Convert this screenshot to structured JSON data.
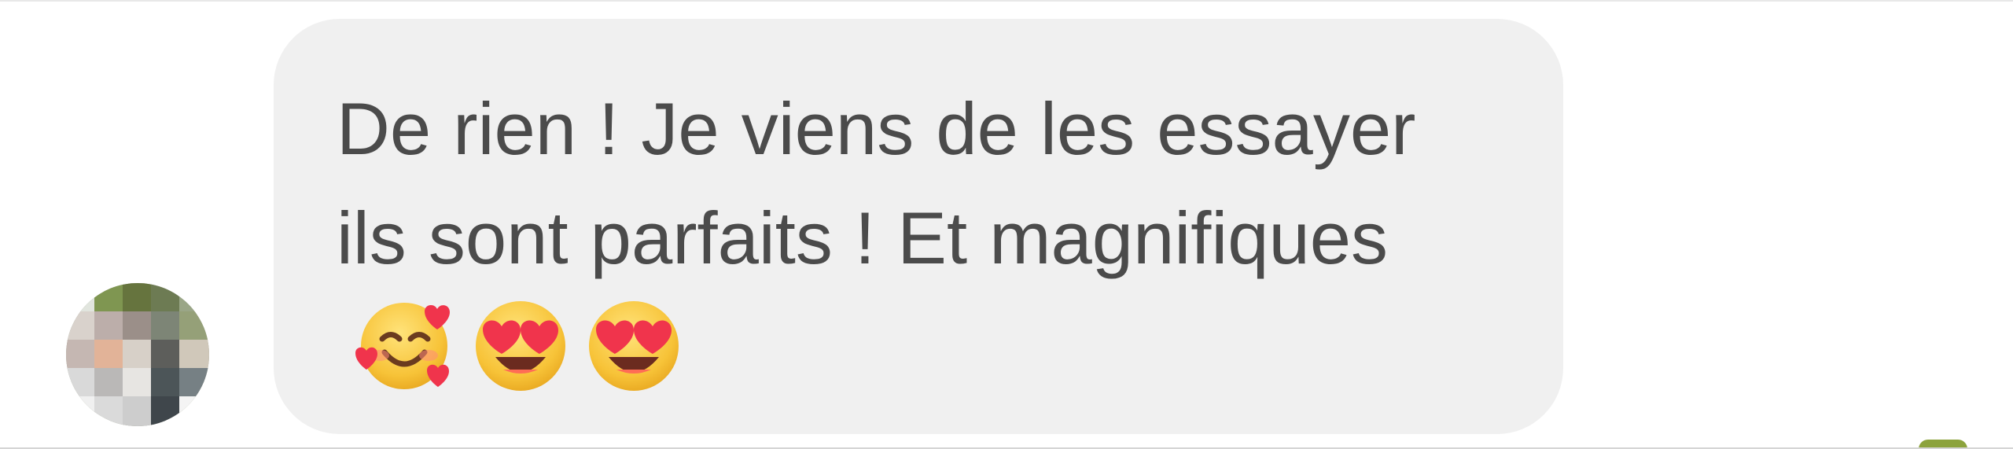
{
  "message": {
    "text": "De rien ! Je viens de les essayer ils sont parfaits ! Et magnifiques",
    "emojis": [
      "smiling-face-with-hearts-icon",
      "heart-eyes-icon",
      "heart-eyes-icon"
    ]
  },
  "colors": {
    "background": "#ffffff",
    "bubble": "#f0f0f0",
    "text": "#4b4b4b"
  }
}
